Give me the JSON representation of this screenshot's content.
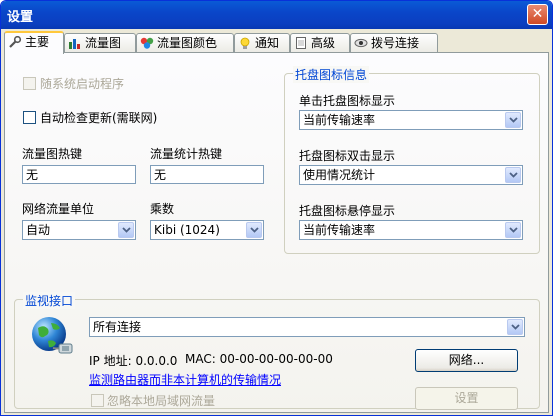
{
  "window": {
    "title": "设置",
    "close_label": "✕"
  },
  "tabs": [
    {
      "label": "主要",
      "icon": "wrench-icon"
    },
    {
      "label": "流量图",
      "icon": "bar-chart-icon"
    },
    {
      "label": "流量图颜色",
      "icon": "palette-icon"
    },
    {
      "label": "通知",
      "icon": "lightbulb-icon"
    },
    {
      "label": "高级",
      "icon": "document-icon"
    },
    {
      "label": "拨号连接",
      "icon": "eye-icon"
    }
  ],
  "general": {
    "autostart_label": "随系统启动程序",
    "autoupdate_label": "自动检查更新(需联网)",
    "graph_hotkey_label": "流量图热键",
    "graph_hotkey_value": "无",
    "stats_hotkey_label": "流量统计热键",
    "stats_hotkey_value": "无",
    "unit_label": "网络流量单位",
    "unit_value": "自动",
    "multiplier_label": "乘数",
    "multiplier_value": "Kibi (1024)"
  },
  "tray": {
    "group_title": "托盘图标信息",
    "single_click_label": "单击托盘图标显示",
    "single_click_value": "当前传输速率",
    "double_click_label": "托盘图标双击显示",
    "double_click_value": "使用情况统计",
    "hover_label": "托盘图标悬停显示",
    "hover_value": "当前传输速率"
  },
  "monitor": {
    "group_title": "监视接口",
    "interface_value": "所有连接",
    "ip_text": "IP 地址: 0.0.0.0",
    "mac_text": "MAC: 00-00-00-00-00-00",
    "network_button": "网络...",
    "router_link": "监测路由器而非本计算机的传输情况",
    "ignore_lan_label": "忽略本地局域网流量",
    "settings_button": "设置"
  },
  "colors": {
    "title_bar": "#0a46c9",
    "link": "#0000ff",
    "group_title": "#0046d5",
    "active_tab_accent": "#ffc83c"
  }
}
